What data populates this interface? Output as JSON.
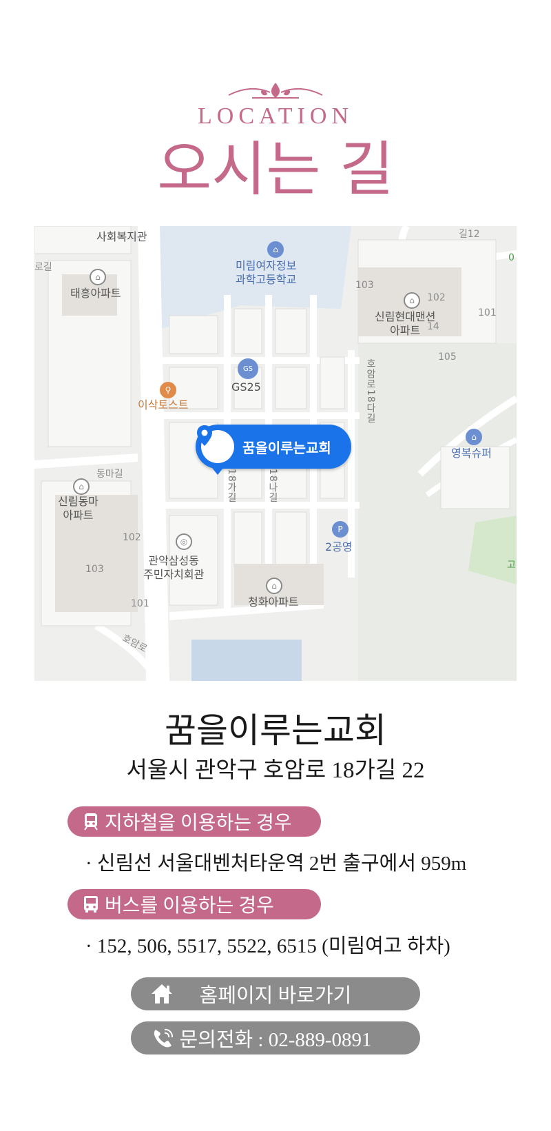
{
  "header": {
    "location_label": "LOCATION",
    "title": "오시는 길"
  },
  "map": {
    "marker_label": "꿈을이루는교회",
    "labels": {
      "welfare": "사회복지관",
      "road_left": "로길",
      "taeheung": "태흥아파트",
      "school": "미림여자정보\n과학고등학교",
      "num103_a": "103",
      "num102_a": "102",
      "num101_a": "101",
      "num105": "105",
      "num14": "14",
      "sillim_hyundai": "신림현대맨션\n아파트",
      "gs25": "GS25",
      "isak": "이삭토스트",
      "hoam18da": "호암로18다길",
      "youngbok": "영복슈퍼",
      "dongma_road": "동마길",
      "sillim_dongma": "신림동마\n아파트",
      "gil18ga": "18가길",
      "gil18na": "18나길",
      "num102_b": "102",
      "num103_b": "103",
      "num101_b": "101",
      "samseong": "관악삼성동\n주민자치회관",
      "parking": "2공영",
      "chunghwa": "청화아파트",
      "hoam_road": "호암로",
      "gil12": "길12",
      "edge_go": "고",
      "edge_0": "0"
    },
    "poi_glyphs": {
      "school": "⌂",
      "apt": "⌂",
      "gs25": "GS",
      "food": "⚲",
      "store": "⌂",
      "parking": "P",
      "civic": "◎"
    }
  },
  "church": {
    "name": "꿈을이루는교회",
    "address": "서울시 관악구 호암로 18가길 22"
  },
  "transport": {
    "subway_label": "지하철을 이용하는 경우",
    "subway_info": "· 신림선 서울대벤처타운역 2번 출구에서 959m",
    "bus_label": "버스를 이용하는 경우",
    "bus_info": "· 152, 506, 5517, 5522, 6515 (미림여고 하차)"
  },
  "buttons": {
    "homepage": "홈페이지 바로가기",
    "phone": "문의전화 : 02-889-0891"
  },
  "colors": {
    "accent": "#c4698a",
    "button_gray": "#8b8b8b",
    "marker_blue": "#1a73e8"
  }
}
